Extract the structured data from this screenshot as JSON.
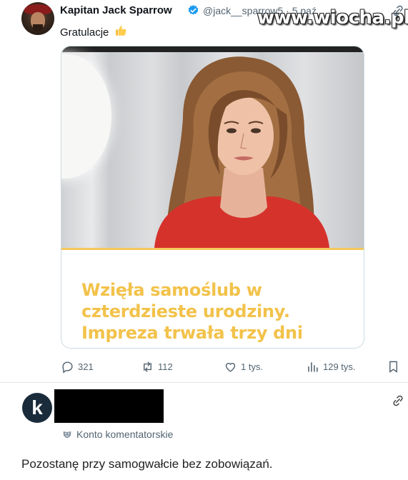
{
  "tweet": {
    "author_name": "Kapitan Jack Sparrow",
    "handle": "@jack__sparrow5 · 5 paź",
    "text": "Gratulacje",
    "text_emoji_icon": "thumbs-up-icon",
    "media": {
      "headline_lines": [
        "Wzięła samoślub w",
        "czterdzieste urodziny.",
        "Impreza trwała trzy dni"
      ],
      "headline_color": "#f2c24a"
    },
    "actions": {
      "replies": "321",
      "retweets": "112",
      "likes": "1 tys.",
      "views": "129 tys."
    }
  },
  "watermark": "www.wiocha.pl",
  "comment": {
    "avatar_letter": "k",
    "badge": "Konto komentatorskie",
    "text": "Pozostanę przy samogwałcie bez zobowiązań."
  },
  "colors": {
    "verified": "#1d9bf0",
    "muted_text": "#536471",
    "avatar_bg": "#1a2b3b"
  }
}
